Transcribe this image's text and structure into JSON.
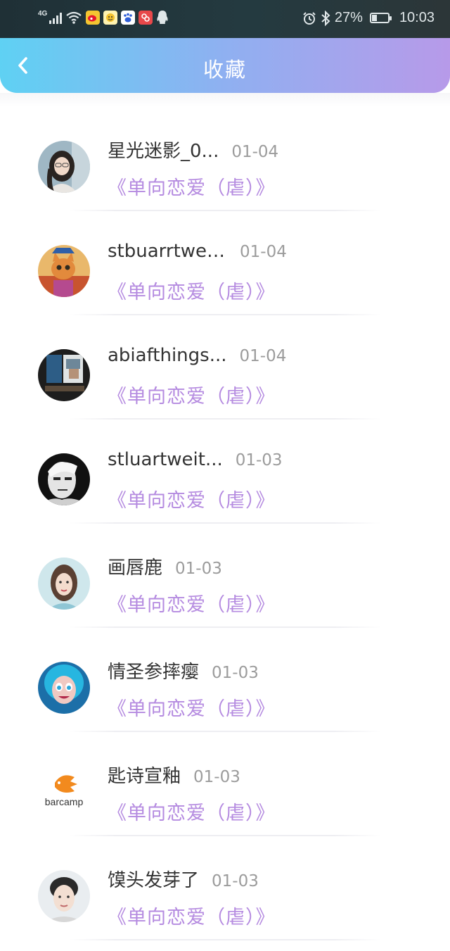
{
  "status_bar": {
    "network": "4G",
    "battery_percent": "27%",
    "battery_level": 0.27,
    "time": "10:03",
    "icons": [
      "signal-icon",
      "wifi-icon",
      "weibo-icon",
      "qq-browser-icon",
      "baidu-icon",
      "music-icon",
      "qq-icon",
      "alarm-icon",
      "bluetooth-icon",
      "battery-icon"
    ]
  },
  "nav": {
    "title": "收藏",
    "back_icon": "chevron-left-icon"
  },
  "favorites": [
    {
      "name": "星光迷影_0...",
      "date": "01-04",
      "book": "《单向恋爱（虐）》",
      "avatar": "girl-with-glasses"
    },
    {
      "name": "stbuarrtwei...",
      "date": "01-04",
      "book": "《单向恋爱（虐）》",
      "avatar": "cartoon-cat"
    },
    {
      "name": "abiafthings...",
      "date": "01-04",
      "book": "《单向恋爱（虐）》",
      "avatar": "window-photo"
    },
    {
      "name": "stluartweit...",
      "date": "01-03",
      "book": "《单向恋爱（虐）》",
      "avatar": "black-white-portrait"
    },
    {
      "name": "画唇鹿",
      "date": "01-03",
      "book": "《单向恋爱（虐）》",
      "avatar": "painted-woman"
    },
    {
      "name": "情圣参摔瘿",
      "date": "01-03",
      "book": "《单向恋爱（虐）》",
      "avatar": "blue-hair-girl"
    },
    {
      "name": "匙诗宣釉",
      "date": "01-03",
      "book": "《单向恋爱（虐）》",
      "avatar": "barcamp-logo"
    },
    {
      "name": "馍头发芽了",
      "date": "01-03",
      "book": "《单向恋爱（虐）》",
      "avatar": "young-man"
    }
  ],
  "colors": {
    "nav_gradient_start": "#5fd1f3",
    "nav_gradient_end": "#b79ae9",
    "book_title": "#b58be0",
    "date": "#9c9c9c",
    "name": "#333333"
  }
}
